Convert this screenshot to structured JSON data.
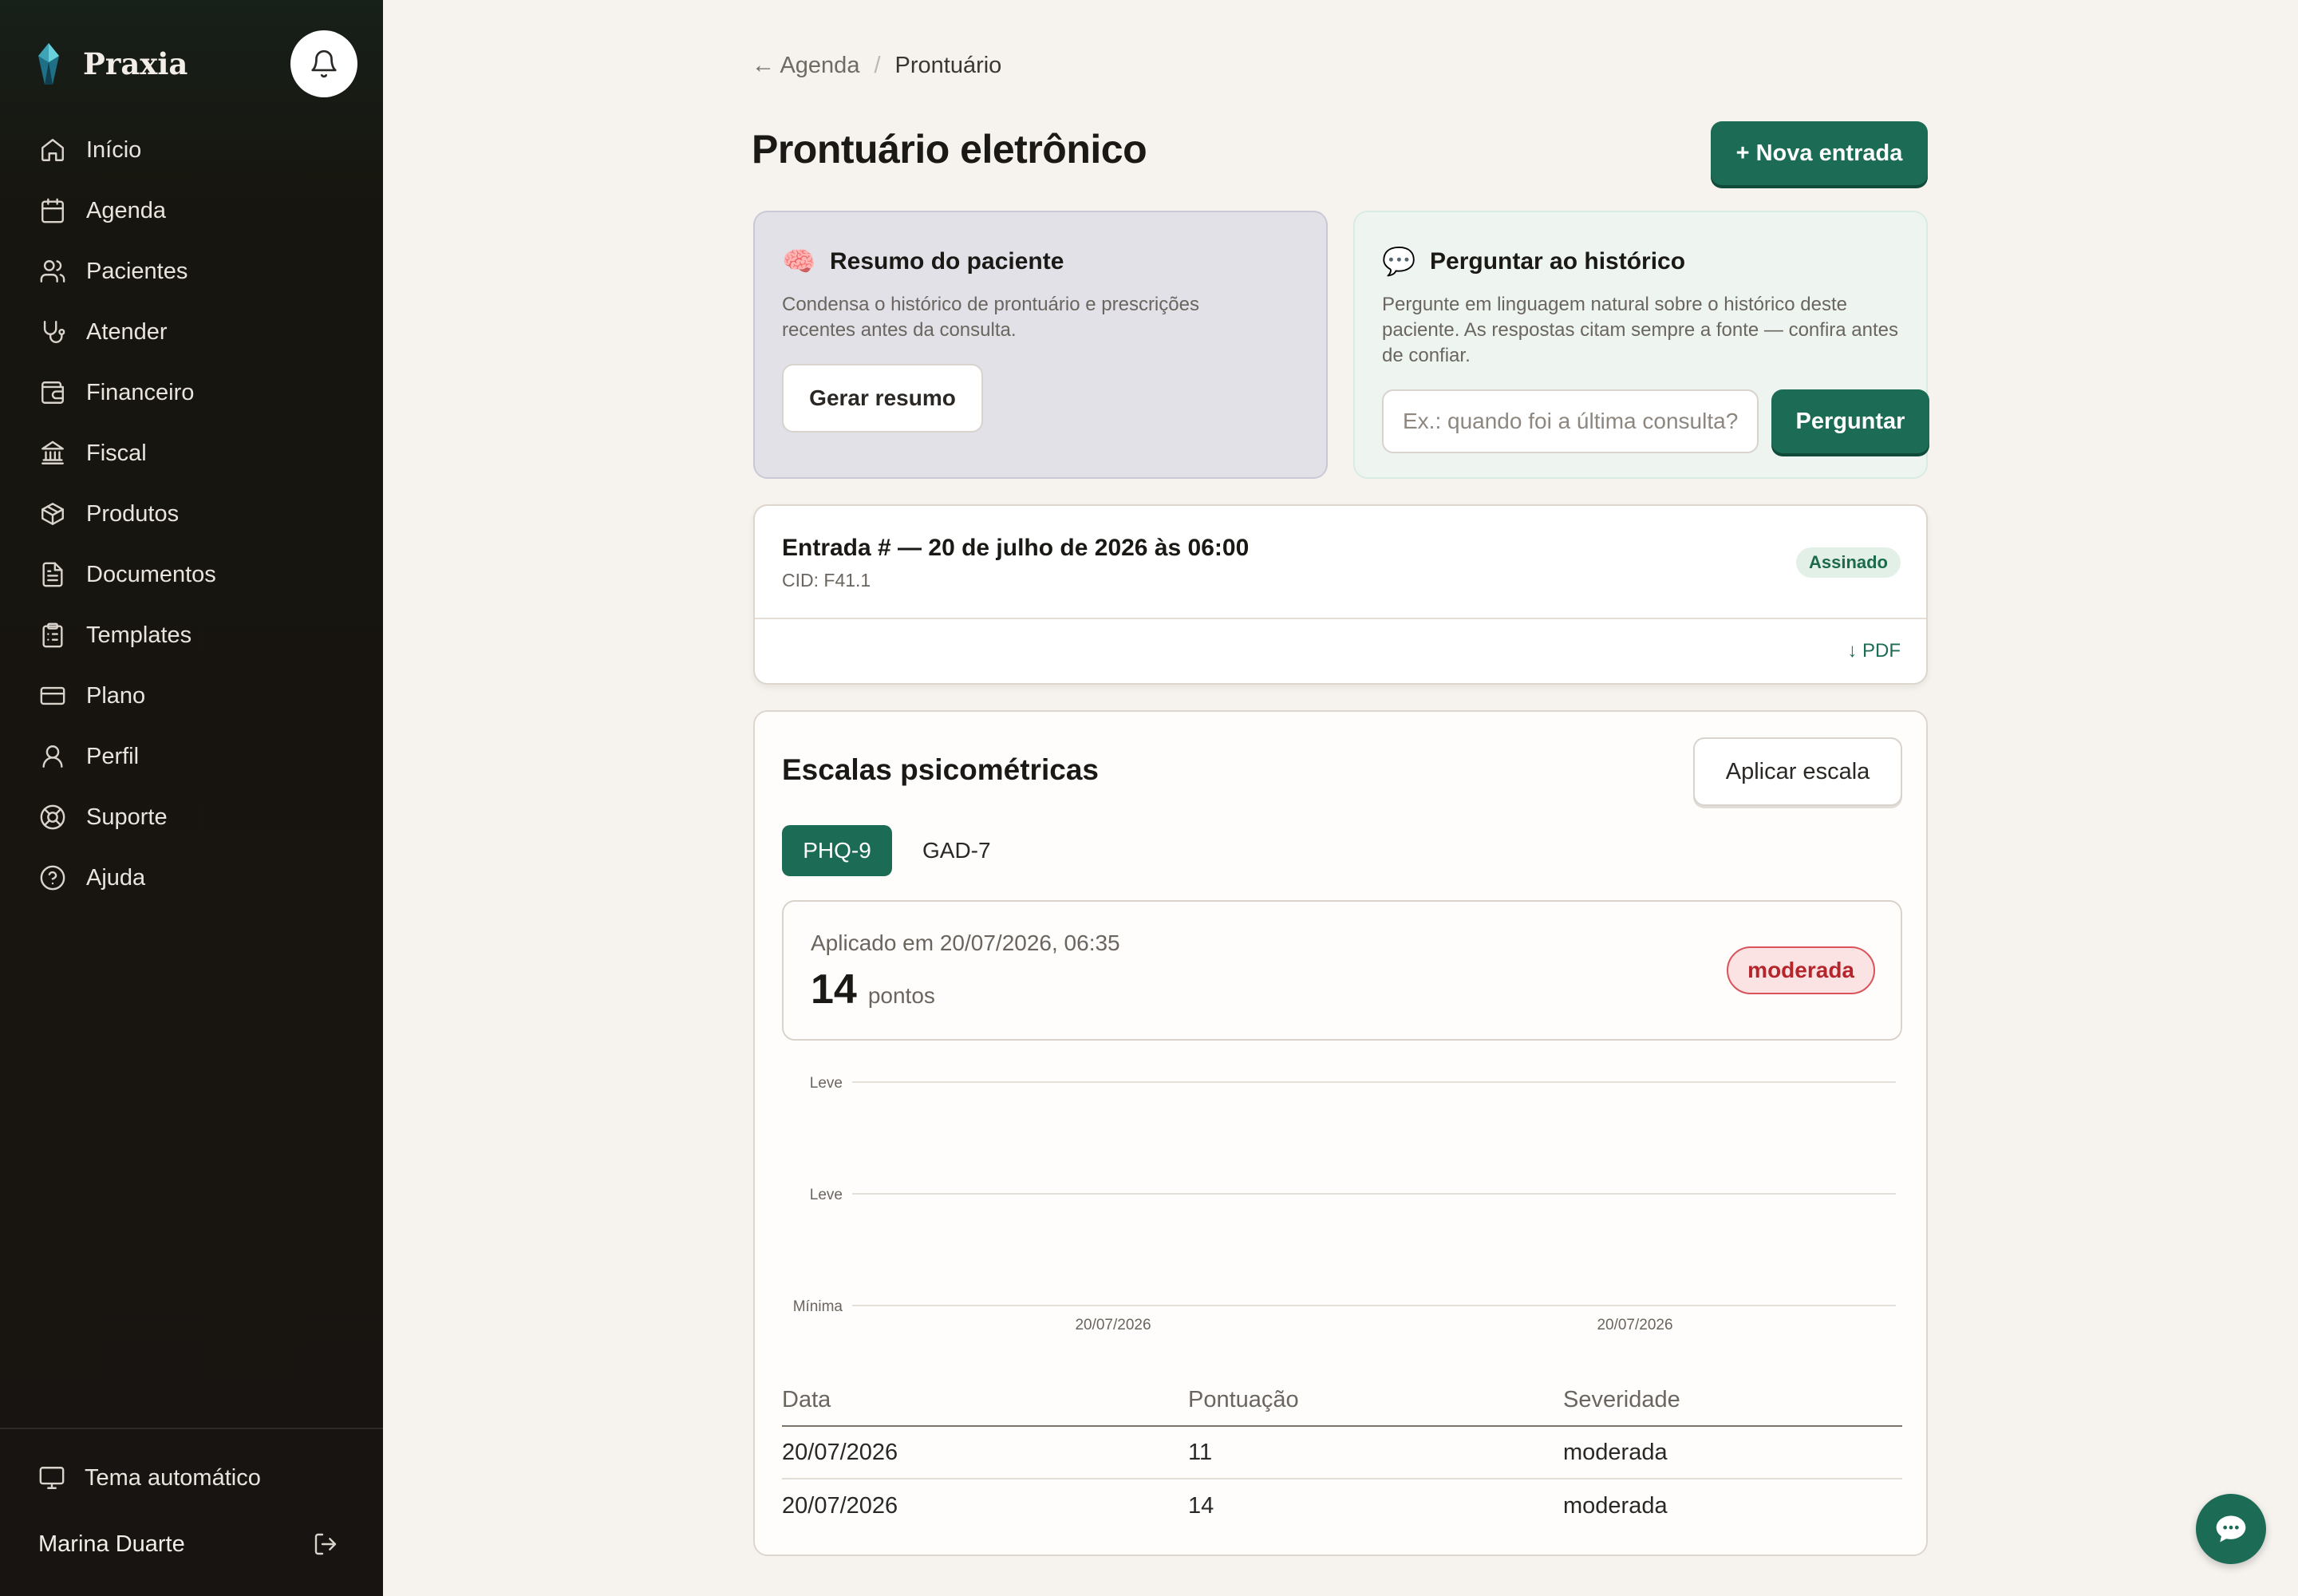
{
  "app": {
    "name": "Praxia"
  },
  "sidebar": {
    "items": [
      {
        "label": "Início",
        "icon": "home-icon"
      },
      {
        "label": "Agenda",
        "icon": "calendar-icon"
      },
      {
        "label": "Pacientes",
        "icon": "users-icon"
      },
      {
        "label": "Atender",
        "icon": "stethoscope-icon"
      },
      {
        "label": "Financeiro",
        "icon": "wallet-icon"
      },
      {
        "label": "Fiscal",
        "icon": "bank-icon"
      },
      {
        "label": "Produtos",
        "icon": "package-icon"
      },
      {
        "label": "Documentos",
        "icon": "document-icon"
      },
      {
        "label": "Templates",
        "icon": "clipboard-list-icon"
      },
      {
        "label": "Plano",
        "icon": "credit-card-icon"
      },
      {
        "label": "Perfil",
        "icon": "user-icon"
      },
      {
        "label": "Suporte",
        "icon": "lifebuoy-icon"
      },
      {
        "label": "Ajuda",
        "icon": "help-circle-icon"
      }
    ],
    "theme_label": "Tema automático",
    "user_name": "Marina Duarte"
  },
  "breadcrumb": {
    "back_label": "← Agenda",
    "separator": "/",
    "current": "Prontuário"
  },
  "page": {
    "title": "Prontuário eletrônico",
    "new_entry_label": "+ Nova entrada"
  },
  "summary_card": {
    "emoji": "🧠",
    "title": "Resumo do paciente",
    "description": "Condensa o histórico de prontuário e prescrições recentes antes da consulta.",
    "button_label": "Gerar resumo"
  },
  "ask_card": {
    "emoji": "💬",
    "title": "Perguntar ao histórico",
    "description": "Pergunte em linguagem natural sobre o histórico deste paciente. As respostas citam sempre a fonte — confira antes de confiar.",
    "input_placeholder": "Ex.: quando foi a última consulta?",
    "button_label": "Perguntar"
  },
  "entry": {
    "title": "Entrada # — 20 de julho de 2026 às 06:00",
    "cid": "CID: F41.1",
    "status": "Assinado",
    "pdf_label": "↓ PDF"
  },
  "scales": {
    "title": "Escalas psicométricas",
    "apply_label": "Aplicar escala",
    "tabs": [
      "PHQ-9",
      "GAD-7"
    ],
    "active_tab": "PHQ-9",
    "result": {
      "applied_label": "Aplicado em 20/07/2026, 06:35",
      "score": "14",
      "unit": "pontos",
      "severity": "moderada"
    },
    "table": {
      "headers": [
        "Data",
        "Pontuação",
        "Severidade"
      ],
      "rows": [
        [
          "20/07/2026",
          "11",
          "moderada"
        ],
        [
          "20/07/2026",
          "14",
          "moderada"
        ]
      ]
    }
  },
  "chart_data": {
    "type": "line",
    "x": [
      "20/07/2026",
      "20/07/2026"
    ],
    "y_tick_labels": [
      "Leve",
      "Leve",
      "Mínima"
    ],
    "series": [],
    "grid": true
  },
  "colors": {
    "accent": "#1b6b55",
    "danger": "#b4252c",
    "sidebar_bg": "#181411",
    "page_bg": "#f6f2ee"
  }
}
